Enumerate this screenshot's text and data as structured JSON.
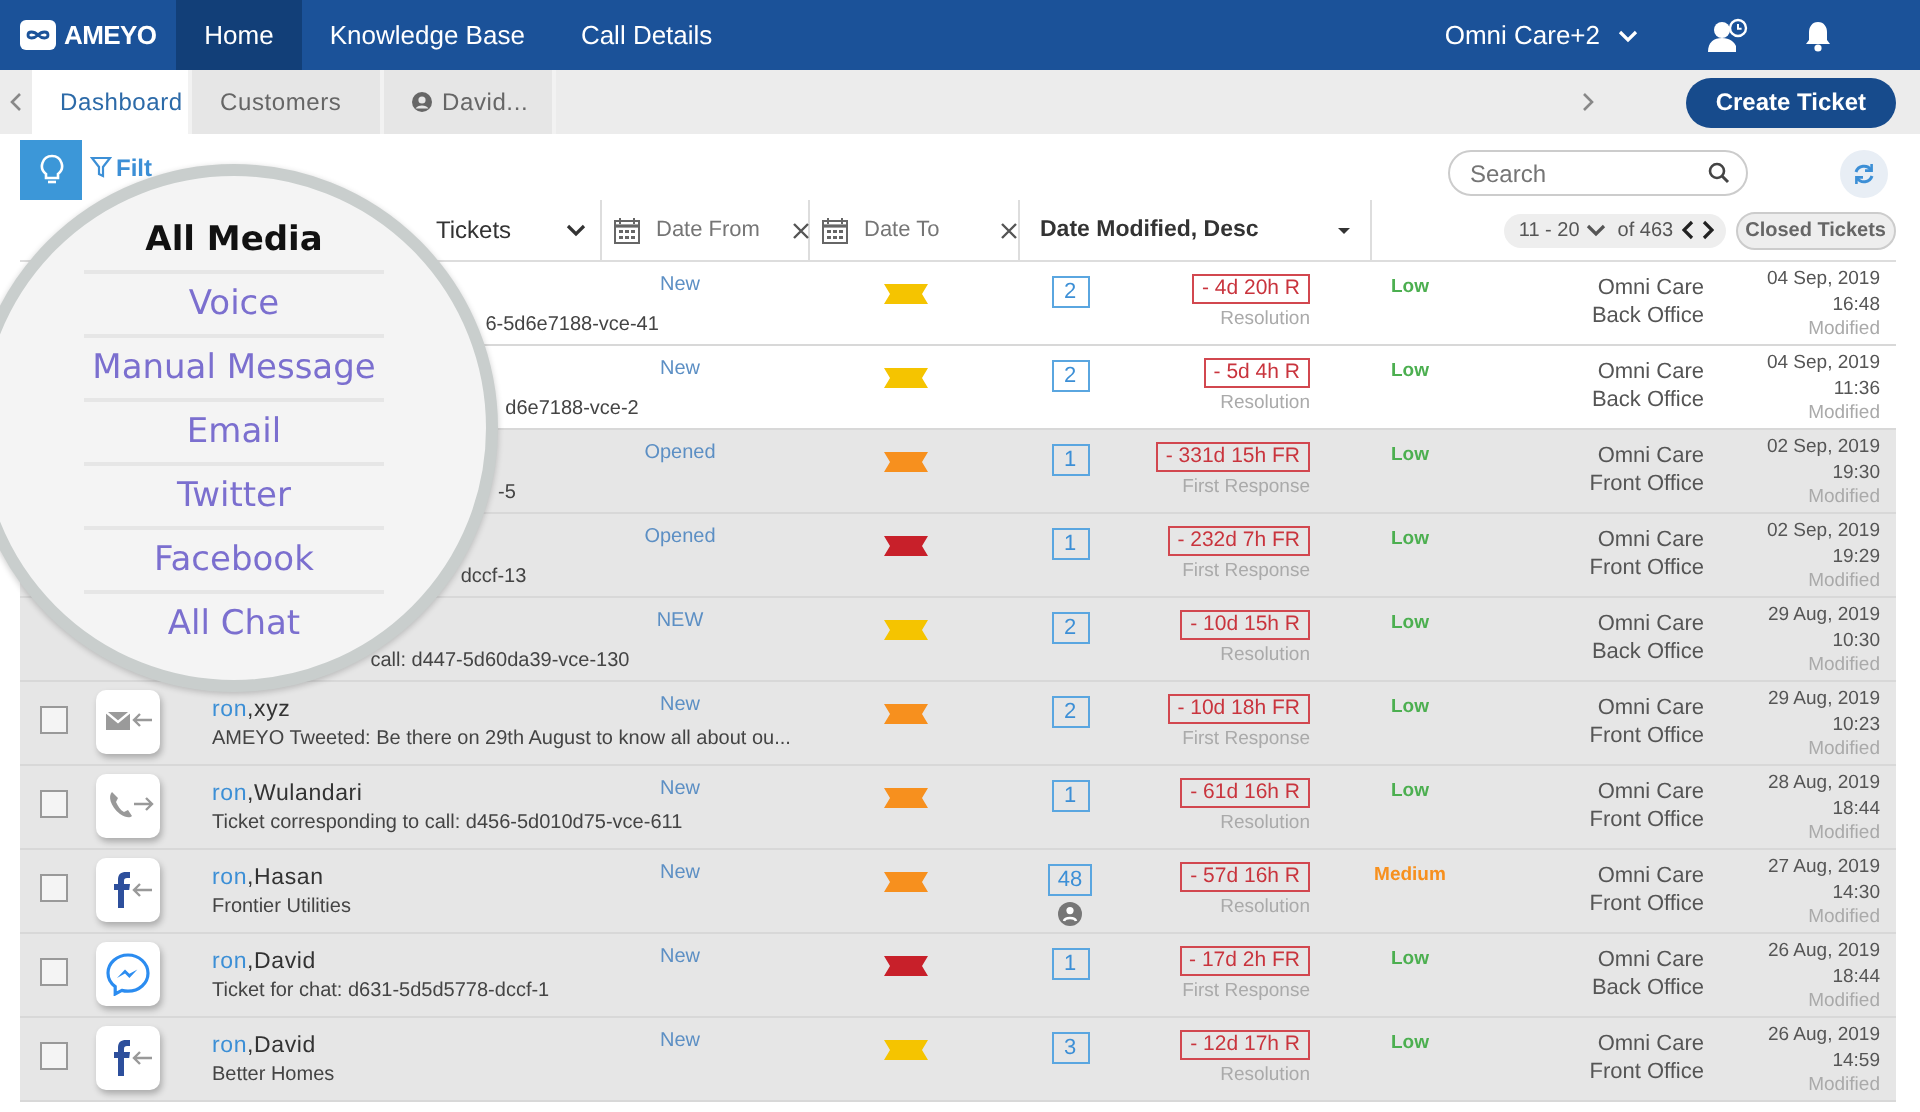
{
  "header": {
    "logo": "AMEYO",
    "nav": [
      {
        "label": "Home",
        "selected": true
      },
      {
        "label": "Knowledge Base",
        "selected": false
      },
      {
        "label": "Call Details",
        "selected": false
      }
    ],
    "account": "Omni Care+2"
  },
  "tabs": {
    "items": [
      {
        "label": "Dashboard",
        "selected": true,
        "kind": "page"
      },
      {
        "label": "Customers",
        "selected": false,
        "kind": "page"
      },
      {
        "label": "David...",
        "selected": false,
        "kind": "contact"
      }
    ],
    "create_button": "Create Ticket"
  },
  "toolbar": {
    "filter_label": "Filt",
    "search": {
      "placeholder": "Search"
    }
  },
  "table_header": {
    "view_select": "Tickets",
    "date_from": {
      "placeholder": "Date From"
    },
    "date_to": {
      "placeholder": "Date To"
    },
    "sort": "Date Modified, Desc",
    "pagination": {
      "range": "11 - 20",
      "total": "of 463"
    },
    "closed_button": "Closed Tickets"
  },
  "media_menu": [
    {
      "label": "All Media",
      "selected": true
    },
    {
      "label": "Voice",
      "selected": false
    },
    {
      "label": "Manual Message",
      "selected": false
    },
    {
      "label": "Email",
      "selected": false
    },
    {
      "label": "Twitter",
      "selected": false
    },
    {
      "label": "Facebook",
      "selected": false
    },
    {
      "label": "All Chat",
      "selected": false
    }
  ],
  "rows": [
    {
      "subtitle": "6-5d6e7188-vce-41",
      "status": "New",
      "ticket": {
        "color": "#f5c400"
      },
      "count": "2",
      "merged": false,
      "sla": "- 4d 20h R",
      "sla_type": "Resolution",
      "priority": {
        "label": "Low",
        "color": "#4caf50"
      },
      "team": [
        "Omni Care",
        "Back Office"
      ],
      "date": "04 Sep, 2019",
      "time": "16:48",
      "modified": "Modified",
      "highlighted": false
    },
    {
      "subtitle": "d6e7188-vce-2",
      "status": "New",
      "ticket": {
        "color": "#f5c400"
      },
      "count": "2",
      "merged": false,
      "sla": "- 5d 4h R",
      "sla_type": "Resolution",
      "priority": {
        "label": "Low",
        "color": "#4caf50"
      },
      "team": [
        "Omni Care",
        "Back Office"
      ],
      "date": "04 Sep, 2019",
      "time": "11:36",
      "modified": "Modified",
      "highlighted": false
    },
    {
      "subtitle": "-5",
      "status": "Opened",
      "ticket": {
        "color": "#f7901e"
      },
      "count": "1",
      "merged": false,
      "sla": "- 331d 15h FR",
      "sla_type": "First Response",
      "priority": {
        "label": "Low",
        "color": "#4caf50"
      },
      "team": [
        "Omni Care",
        "Front Office"
      ],
      "date": "02 Sep, 2019",
      "time": "19:30",
      "modified": "Modified",
      "highlighted": true
    },
    {
      "subtitle": "dccf-13",
      "status": "Opened",
      "ticket": {
        "color": "#c8202a"
      },
      "count": "1",
      "merged": false,
      "sla": "- 232d 7h FR",
      "sla_type": "First Response",
      "priority": {
        "label": "Low",
        "color": "#4caf50"
      },
      "team": [
        "Omni Care",
        "Front Office"
      ],
      "date": "02 Sep, 2019",
      "time": "19:29",
      "modified": "Modified",
      "highlighted": true
    },
    {
      "subtitle": "call: d447-5d60da39-vce-130",
      "status": "NEW",
      "ticket": {
        "color": "#f5c400"
      },
      "count": "2",
      "merged": false,
      "sla": "- 10d 15h R",
      "sla_type": "Resolution",
      "priority": {
        "label": "Low",
        "color": "#4caf50"
      },
      "team": [
        "Omni Care",
        "Back Office"
      ],
      "date": "29 Aug, 2019",
      "time": "10:30",
      "modified": "Modified",
      "highlighted": true
    },
    {
      "checked": false,
      "kind": "email",
      "name": "ron,xyz",
      "subtitle": "AMEYO Tweeted: Be there on 29th August to know all about ou...",
      "status": "New",
      "ticket": {
        "color": "#f7901e"
      },
      "count": "2",
      "merged": false,
      "sla": "- 10d 18h FR",
      "sla_type": "First Response",
      "priority": {
        "label": "Low",
        "color": "#4caf50"
      },
      "team": [
        "Omni Care",
        "Front Office"
      ],
      "date": "29 Aug, 2019",
      "time": "10:23",
      "modified": "Modified",
      "highlighted": true
    },
    {
      "checked": false,
      "kind": "call",
      "name": "ron,Wulandari",
      "subtitle": "Ticket corresponding to call: d456-5d010d75-vce-611",
      "status": "New",
      "ticket": {
        "color": "#f7901e"
      },
      "count": "1",
      "merged": false,
      "sla": "- 61d 16h R",
      "sla_type": "Resolution",
      "priority": {
        "label": "Low",
        "color": "#4caf50"
      },
      "team": [
        "Omni Care",
        "Front Office"
      ],
      "date": "28 Aug, 2019",
      "time": "18:44",
      "modified": "Modified",
      "highlighted": true
    },
    {
      "checked": false,
      "kind": "facebook",
      "name": "ron,Hasan",
      "subtitle": "Frontier Utilities",
      "status": "New",
      "ticket": {
        "color": "#f7901e"
      },
      "count": "48",
      "merged": true,
      "sla": "- 57d 16h R",
      "sla_type": "Resolution",
      "priority": {
        "label": "Medium",
        "color": "#f7901e"
      },
      "team": [
        "Omni Care",
        "Front Office"
      ],
      "date": "27 Aug, 2019",
      "time": "14:30",
      "modified": "Modified",
      "highlighted": true
    },
    {
      "checked": false,
      "kind": "messenger",
      "name": "ron,David",
      "subtitle": "Ticket for chat: d631-5d5d5778-dccf-1",
      "status": "New",
      "ticket": {
        "color": "#c8202a"
      },
      "count": "1",
      "merged": false,
      "sla": "- 17d 2h FR",
      "sla_type": "First Response",
      "priority": {
        "label": "Low",
        "color": "#4caf50"
      },
      "team": [
        "Omni Care",
        "Back Office"
      ],
      "date": "26 Aug, 2019",
      "time": "18:44",
      "modified": "Modified",
      "highlighted": true
    },
    {
      "checked": false,
      "kind": "facebook",
      "name": "ron,David",
      "subtitle": "Better Homes",
      "status": "New",
      "ticket": {
        "color": "#f5c400"
      },
      "count": "3",
      "merged": false,
      "sla": "- 12d 17h R",
      "sla_type": "Resolution",
      "priority": {
        "label": "Low",
        "color": "#4caf50"
      },
      "team": [
        "Omni Care",
        "Front Office"
      ],
      "date": "26 Aug, 2019",
      "time": "14:59",
      "modified": "Modified",
      "highlighted": true
    }
  ]
}
